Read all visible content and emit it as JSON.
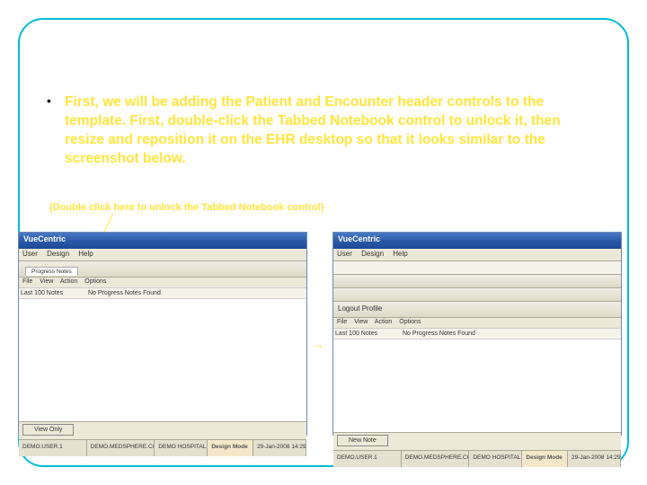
{
  "bullet": "•",
  "instruction": "First, we will be adding the Patient and Encounter header controls to the template.  First, double-click the Tabbed Notebook control to unlock it, then resize and reposition it on the EHR desktop so that it looks similar to the screenshot below.",
  "hint": "(Double click here to unlock the Tabbed Notebook control)",
  "arrow": "→",
  "app": {
    "title": "VueCentric",
    "menu": {
      "m1": "User",
      "m2": "Design",
      "m3": "Help"
    },
    "patient_band": "Logout Profile",
    "left_header": "Last 100 Notes",
    "right_header": "No Progress Notes Found",
    "submenu": {
      "s1": "File",
      "s2": "View",
      "s3": "Action",
      "s4": "Options"
    },
    "btn_left": "View Only",
    "btn_right": "New Note",
    "status": {
      "c1": "DEMO.USER.1",
      "c2": "DEMO.MEDSPHERE.COM",
      "c3": "DEMO HOSPITAL",
      "c4": "Design Mode",
      "c5": "29-Jan-2008 14:29"
    },
    "tab": "Progress Notes"
  }
}
